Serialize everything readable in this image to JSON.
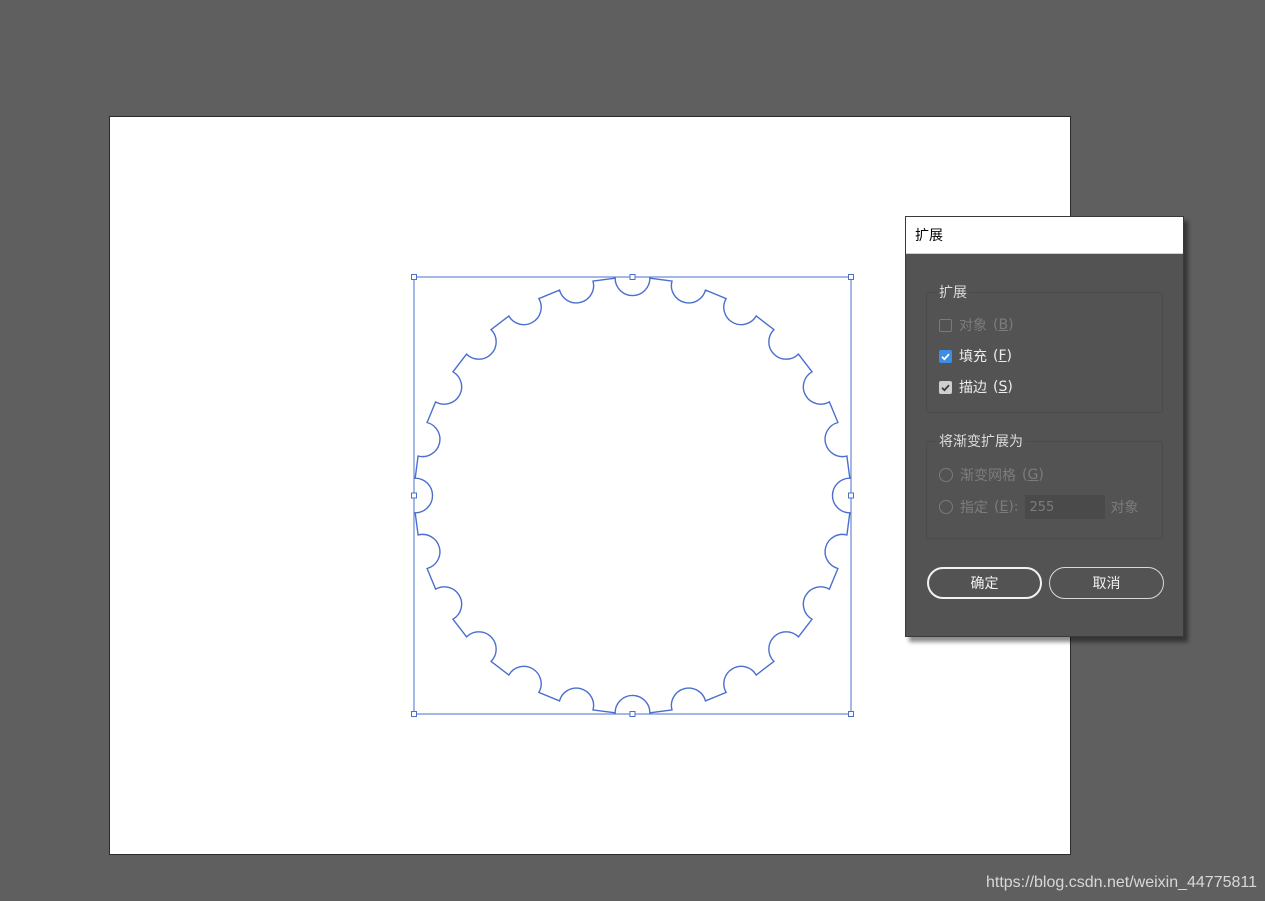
{
  "canvas": {
    "colors": {
      "workspace": "#5f5f5f",
      "artboard": "#ffffff",
      "selection": "#4a6fcf"
    },
    "shape": {
      "type": "scalloped-circle",
      "notches": 24,
      "stroke_color": "#4a6fcf",
      "fill_color": "none"
    }
  },
  "dialog": {
    "title": "扩展",
    "expand_group": {
      "legend": "扩展",
      "object": {
        "label": "对象",
        "hotkey": "B",
        "checked": false,
        "enabled": false
      },
      "fill": {
        "label": "填充",
        "hotkey": "F",
        "checked": true,
        "enabled": true
      },
      "stroke": {
        "label": "描边",
        "hotkey": "S",
        "checked": true,
        "enabled": true
      }
    },
    "gradient_group": {
      "legend": "将渐变扩展为",
      "mesh": {
        "label": "渐变网格",
        "hotkey": "G",
        "selected": false,
        "enabled": false
      },
      "specify": {
        "label": "指定",
        "hotkey": "E",
        "selected": false,
        "enabled": false,
        "value": "255",
        "unit": "对象"
      }
    },
    "buttons": {
      "ok": "确定",
      "cancel": "取消"
    },
    "colors": {
      "background": "#535353",
      "checkbox_blue": "#3d8ee6"
    }
  },
  "watermark": "https://blog.csdn.net/weixin_44775811"
}
